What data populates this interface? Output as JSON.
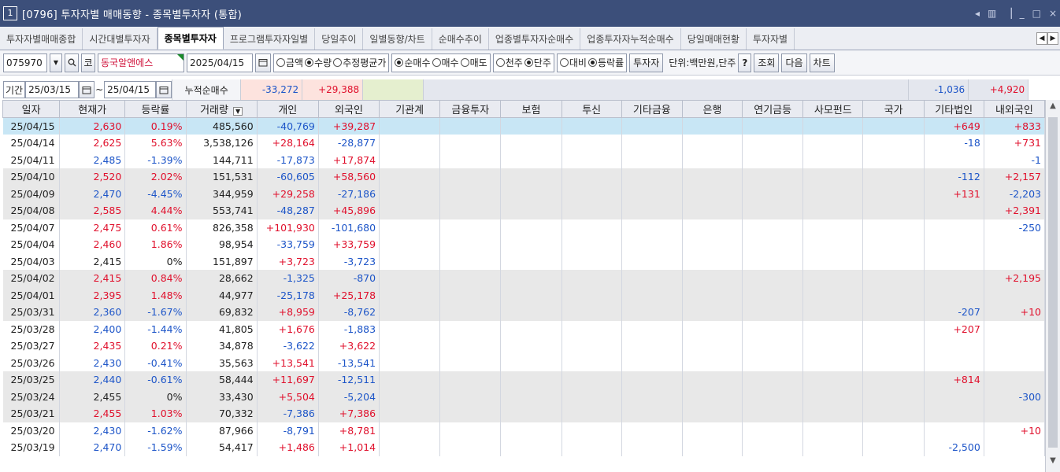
{
  "window": {
    "number": "1",
    "title": "[0796] 투자자별 매매동향 - 종목별투자자 (통합)",
    "controls": [
      "◂",
      "▥",
      "▕",
      "_",
      "□",
      "×"
    ]
  },
  "tabs": [
    {
      "label": "투자자별매매종합",
      "active": false
    },
    {
      "label": "시간대별투자자",
      "active": false
    },
    {
      "label": "종목별투자자",
      "active": true
    },
    {
      "label": "프로그램투자자일별",
      "active": false
    },
    {
      "label": "당일추이",
      "active": false
    },
    {
      "label": "일별동향/차트",
      "active": false
    },
    {
      "label": "순매수추이",
      "active": false
    },
    {
      "label": "업종별투자자순매수",
      "active": false
    },
    {
      "label": "업종투자자누적순매수",
      "active": false
    },
    {
      "label": "당일매매현황",
      "active": false
    },
    {
      "label": "투자자별",
      "active": false
    }
  ],
  "toolbar": {
    "code": "075970",
    "market_tag": "코",
    "stock_name": "동국알앤에스",
    "date": "2025/04/15",
    "amount_opts": [
      {
        "label": "금액",
        "on": false
      },
      {
        "label": "수량",
        "on": true
      },
      {
        "label": "추정평균가",
        "on": false
      }
    ],
    "trade_opts": [
      {
        "label": "순매수",
        "on": true
      },
      {
        "label": "매수",
        "on": false
      },
      {
        "label": "매도",
        "on": false
      }
    ],
    "unit_opts": [
      {
        "label": "천주",
        "on": false
      },
      {
        "label": "단주",
        "on": true
      }
    ],
    "compare_opts": [
      {
        "label": "대비",
        "on": false
      },
      {
        "label": "등락률",
        "on": true
      }
    ],
    "investor_btn": "투자자",
    "unit_text": "단위:백만원,단주",
    "help_btn": "?",
    "search_btn": "조회",
    "next_btn": "다음",
    "chart_btn": "차트"
  },
  "period": {
    "label": "기간",
    "from": "25/03/15",
    "to": "25/04/15",
    "tilde": "~",
    "cum_label": "누적순매수",
    "cum_individual": "-33,272",
    "cum_foreign": "+29,388",
    "cum_other_corp": "-1,036",
    "cum_dom_foreign": "+4,920"
  },
  "columns": [
    "일자",
    "현재가",
    "등락률",
    "거래량",
    "개인",
    "외국인",
    "기관계",
    "금융투자",
    "보험",
    "투신",
    "기타금융",
    "은행",
    "연기금등",
    "사모펀드",
    "국가",
    "기타법인",
    "내외국인"
  ],
  "rows": [
    {
      "date": "25/04/15",
      "price": "2,630",
      "rate": "0.19%",
      "vol": "485,560",
      "ind": "-40,769",
      "frn": "+39,287",
      "etc": "+649",
      "dom": "+833",
      "dir": "up",
      "style": "sel"
    },
    {
      "date": "25/04/14",
      "price": "2,625",
      "rate": "5.63%",
      "vol": "3,538,126",
      "ind": "+28,164",
      "frn": "-28,877",
      "etc": "-18",
      "dom": "+731",
      "dir": "up",
      "style": ""
    },
    {
      "date": "25/04/11",
      "price": "2,485",
      "rate": "-1.39%",
      "vol": "144,711",
      "ind": "-17,873",
      "frn": "+17,874",
      "etc": "",
      "dom": "-1",
      "dir": "down",
      "style": ""
    },
    {
      "date": "25/04/10",
      "price": "2,520",
      "rate": "2.02%",
      "vol": "151,531",
      "ind": "-60,605",
      "frn": "+58,560",
      "etc": "-112",
      "dom": "+2,157",
      "dir": "up",
      "style": "shade"
    },
    {
      "date": "25/04/09",
      "price": "2,470",
      "rate": "-4.45%",
      "vol": "344,959",
      "ind": "+29,258",
      "frn": "-27,186",
      "etc": "+131",
      "dom": "-2,203",
      "dir": "down",
      "style": "shade"
    },
    {
      "date": "25/04/08",
      "price": "2,585",
      "rate": "4.44%",
      "vol": "553,741",
      "ind": "-48,287",
      "frn": "+45,896",
      "etc": "",
      "dom": "+2,391",
      "dir": "up",
      "style": "shade"
    },
    {
      "date": "25/04/07",
      "price": "2,475",
      "rate": "0.61%",
      "vol": "826,358",
      "ind": "+101,930",
      "frn": "-101,680",
      "etc": "",
      "dom": "-250",
      "dir": "up",
      "style": ""
    },
    {
      "date": "25/04/04",
      "price": "2,460",
      "rate": "1.86%",
      "vol": "98,954",
      "ind": "-33,759",
      "frn": "+33,759",
      "etc": "",
      "dom": "",
      "dir": "up",
      "style": ""
    },
    {
      "date": "25/04/03",
      "price": "2,415",
      "rate": "0%",
      "vol": "151,897",
      "ind": "+3,723",
      "frn": "-3,723",
      "etc": "",
      "dom": "",
      "dir": "flat",
      "style": ""
    },
    {
      "date": "25/04/02",
      "price": "2,415",
      "rate": "0.84%",
      "vol": "28,662",
      "ind": "-1,325",
      "frn": "-870",
      "etc": "",
      "dom": "+2,195",
      "dir": "up",
      "style": "shade"
    },
    {
      "date": "25/04/01",
      "price": "2,395",
      "rate": "1.48%",
      "vol": "44,977",
      "ind": "-25,178",
      "frn": "+25,178",
      "etc": "",
      "dom": "",
      "dir": "up",
      "style": "shade"
    },
    {
      "date": "25/03/31",
      "price": "2,360",
      "rate": "-1.67%",
      "vol": "69,832",
      "ind": "+8,959",
      "frn": "-8,762",
      "etc": "-207",
      "dom": "+10",
      "dir": "down",
      "style": "shade"
    },
    {
      "date": "25/03/28",
      "price": "2,400",
      "rate": "-1.44%",
      "vol": "41,805",
      "ind": "+1,676",
      "frn": "-1,883",
      "etc": "+207",
      "dom": "",
      "dir": "down",
      "style": ""
    },
    {
      "date": "25/03/27",
      "price": "2,435",
      "rate": "0.21%",
      "vol": "34,878",
      "ind": "-3,622",
      "frn": "+3,622",
      "etc": "",
      "dom": "",
      "dir": "up",
      "style": ""
    },
    {
      "date": "25/03/26",
      "price": "2,430",
      "rate": "-0.41%",
      "vol": "35,563",
      "ind": "+13,541",
      "frn": "-13,541",
      "etc": "",
      "dom": "",
      "dir": "down",
      "style": ""
    },
    {
      "date": "25/03/25",
      "price": "2,440",
      "rate": "-0.61%",
      "vol": "58,444",
      "ind": "+11,697",
      "frn": "-12,511",
      "etc": "+814",
      "dom": "",
      "dir": "down",
      "style": "shade"
    },
    {
      "date": "25/03/24",
      "price": "2,455",
      "rate": "0%",
      "vol": "33,430",
      "ind": "+5,504",
      "frn": "-5,204",
      "etc": "",
      "dom": "-300",
      "dir": "flat",
      "style": "shade"
    },
    {
      "date": "25/03/21",
      "price": "2,455",
      "rate": "1.03%",
      "vol": "70,332",
      "ind": "-7,386",
      "frn": "+7,386",
      "etc": "",
      "dom": "",
      "dir": "up",
      "style": "shade"
    },
    {
      "date": "25/03/20",
      "price": "2,430",
      "rate": "-1.62%",
      "vol": "87,966",
      "ind": "-8,791",
      "frn": "+8,781",
      "etc": "",
      "dom": "+10",
      "dir": "down",
      "style": ""
    },
    {
      "date": "25/03/19",
      "price": "2,470",
      "rate": "-1.59%",
      "vol": "54,417",
      "ind": "+1,486",
      "frn": "+1,014",
      "etc": "-2,500",
      "dom": "",
      "dir": "down",
      "style": ""
    }
  ]
}
